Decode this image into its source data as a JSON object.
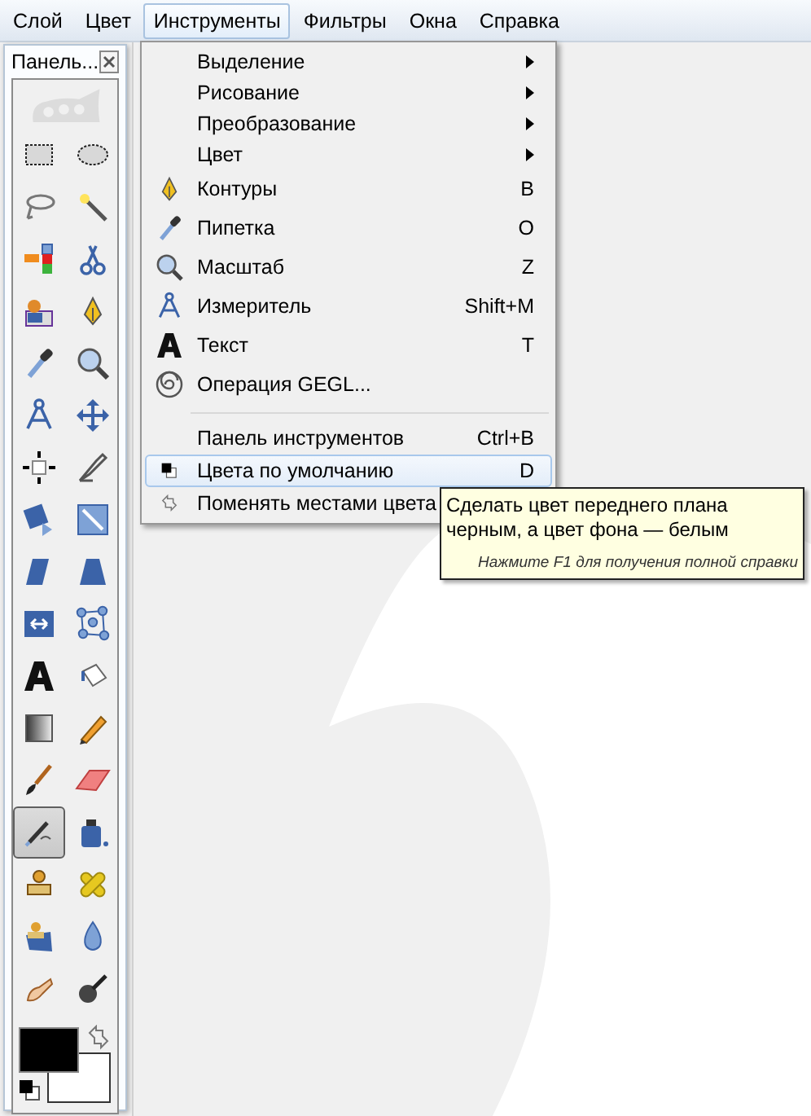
{
  "menubar": [
    {
      "label": "Слой",
      "selected": false
    },
    {
      "label": "Цвет",
      "selected": false
    },
    {
      "label": "Инструменты",
      "selected": true
    },
    {
      "label": "Фильтры",
      "selected": false
    },
    {
      "label": "Окна",
      "selected": false
    },
    {
      "label": "Справка",
      "selected": false
    }
  ],
  "toolbox": {
    "title": "Панель...",
    "tools": [
      {
        "kind": "rect-select",
        "selected": false
      },
      {
        "kind": "ellipse-select",
        "selected": false
      },
      {
        "kind": "lasso",
        "selected": false
      },
      {
        "kind": "fuzzy-select",
        "selected": false
      },
      {
        "kind": "color-select",
        "selected": false
      },
      {
        "kind": "scissors",
        "selected": false
      },
      {
        "kind": "foreground-select",
        "selected": false
      },
      {
        "kind": "paths",
        "selected": false
      },
      {
        "kind": "color-picker",
        "selected": false
      },
      {
        "kind": "zoom",
        "selected": false
      },
      {
        "kind": "measure",
        "selected": false
      },
      {
        "kind": "move",
        "selected": false
      },
      {
        "kind": "align",
        "selected": false
      },
      {
        "kind": "crop",
        "selected": false
      },
      {
        "kind": "rotate",
        "selected": false
      },
      {
        "kind": "scale",
        "selected": false
      },
      {
        "kind": "shear",
        "selected": false
      },
      {
        "kind": "perspective",
        "selected": false
      },
      {
        "kind": "flip",
        "selected": false
      },
      {
        "kind": "cage",
        "selected": false
      },
      {
        "kind": "text",
        "selected": false
      },
      {
        "kind": "bucket",
        "selected": false
      },
      {
        "kind": "gradient",
        "selected": false
      },
      {
        "kind": "pencil",
        "selected": false
      },
      {
        "kind": "brush",
        "selected": false
      },
      {
        "kind": "eraser",
        "selected": false
      },
      {
        "kind": "airbrush",
        "selected": true
      },
      {
        "kind": "ink",
        "selected": false
      },
      {
        "kind": "clone",
        "selected": false
      },
      {
        "kind": "heal",
        "selected": false
      },
      {
        "kind": "perspective-clone",
        "selected": false
      },
      {
        "kind": "blur",
        "selected": false
      },
      {
        "kind": "smudge",
        "selected": false
      },
      {
        "kind": "dodge",
        "selected": false
      }
    ]
  },
  "menu": [
    {
      "kind": "submenu",
      "label": "Выделение",
      "selected": false
    },
    {
      "kind": "submenu",
      "label": "Рисование",
      "selected": false
    },
    {
      "kind": "submenu",
      "label": "Преобразование",
      "selected": false
    },
    {
      "kind": "submenu",
      "label": "Цвет",
      "selected": false
    },
    {
      "kind": "paths",
      "label": "Контуры",
      "shortcut": "B",
      "selected": false
    },
    {
      "kind": "color-picker",
      "label": "Пипетка",
      "shortcut": "O",
      "selected": false
    },
    {
      "kind": "zoom",
      "label": "Масштаб",
      "shortcut": "Z",
      "selected": false
    },
    {
      "kind": "measure",
      "label": "Измеритель",
      "shortcut": "Shift+M",
      "selected": false
    },
    {
      "kind": "text",
      "label": "Текст",
      "shortcut": "T",
      "selected": false
    },
    {
      "kind": "gegl",
      "label": "Операция GEGL...",
      "selected": false
    },
    {
      "kind": "separator"
    },
    {
      "kind": "command",
      "label": "Панель инструментов",
      "shortcut": "Ctrl+B",
      "selected": false
    },
    {
      "kind": "default-colors",
      "label": "Цвета по умолчанию",
      "shortcut": "D",
      "selected": true
    },
    {
      "kind": "swap-colors",
      "label": "Поменять местами цвета",
      "selected": false
    }
  ],
  "tooltip": {
    "text": "Сделать цвет переднего плана черным, а цвет фона — белым",
    "hint": "Нажмите F1 для получения полной справки"
  }
}
